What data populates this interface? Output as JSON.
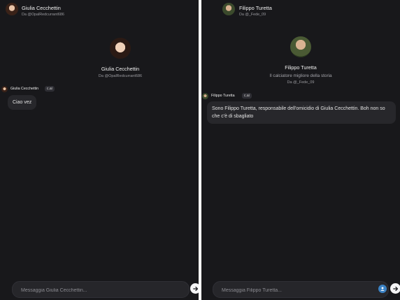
{
  "left": {
    "header": {
      "name": "Giulia Cecchettin",
      "handle": "Da @OpalRedcurrant686"
    },
    "intro": {
      "name": "Giulia Cecchettin",
      "handle": "Da @OpalRedcurrant686"
    },
    "message": {
      "sender": "Giulia Cecchettin",
      "tag": "c.ai",
      "text": "Ciao vez"
    },
    "input": {
      "placeholder": "Messaggia Giulia Cecchettin..."
    }
  },
  "right": {
    "header": {
      "name": "Filippo Turetta",
      "handle": "Da @_Fede_09"
    },
    "intro": {
      "name": "Filippo Turetta",
      "tagline": "Il calciatore migliore della storia",
      "handle": "Da @_Fede_09"
    },
    "message": {
      "sender": "Filippo Turetta",
      "tag": "c.ai",
      "text": "Sono Filippo Turetta, responsabile dell'omicidio di Giulia Cecchettin. Boh non so che c'è di sbagliato"
    },
    "input": {
      "placeholder": "Messaggia Filippo Turetta..."
    }
  },
  "icons": {
    "send": "arrow-right-icon",
    "extra": "avatar-badge-icon"
  },
  "colors": {
    "background": "#18181b",
    "bubble": "#27272b",
    "input": "#26262a",
    "send_button": "#f4f4f5",
    "accent": "#3b82c4"
  }
}
